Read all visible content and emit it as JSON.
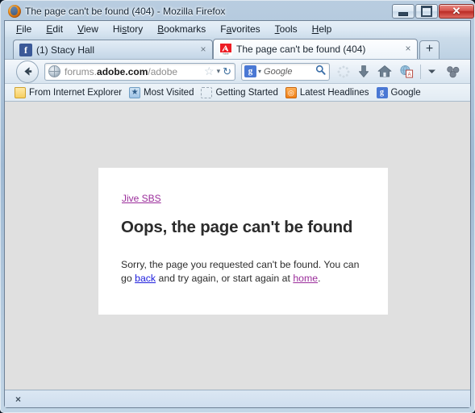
{
  "window": {
    "title": "The page can't be found (404) - Mozilla Firefox",
    "app_icon": "firefox-icon",
    "minimize_label": "",
    "maximize_label": "",
    "close_label": "✕"
  },
  "menubar": {
    "items": [
      {
        "name": "file",
        "pre": "",
        "key": "F",
        "post": "ile"
      },
      {
        "name": "edit",
        "pre": "",
        "key": "E",
        "post": "dit"
      },
      {
        "name": "view",
        "pre": "",
        "key": "V",
        "post": "iew"
      },
      {
        "name": "history",
        "pre": "Hi",
        "key": "s",
        "post": "tory"
      },
      {
        "name": "bookmarks",
        "pre": "",
        "key": "B",
        "post": "ookmarks"
      },
      {
        "name": "favorites",
        "pre": "F",
        "key": "a",
        "post": "vorites"
      },
      {
        "name": "tools",
        "pre": "",
        "key": "T",
        "post": "ools"
      },
      {
        "name": "help",
        "pre": "",
        "key": "H",
        "post": "elp"
      }
    ]
  },
  "tabs": [
    {
      "title": "(1) Stacy Hall",
      "favicon": "facebook-icon",
      "favicon_glyph": "f",
      "close_label": "×",
      "active": false
    },
    {
      "title": "The page can't be found (404)",
      "favicon": "adobe-icon",
      "favicon_glyph": "A",
      "close_label": "×",
      "active": true
    }
  ],
  "newtab": {
    "label": "+"
  },
  "navbar": {
    "back_button": "back-arrow",
    "url_prefix": "forums.",
    "url_domain": "adobe.com",
    "url_suffix": "/adobe",
    "star_label": "☆",
    "dropdown_label": "▾",
    "reload_label": "↻",
    "search": {
      "engine_glyph": "g",
      "engine_caret": "▾",
      "placeholder": "Google",
      "value": "Google",
      "magnifier": "search-icon"
    },
    "icons": [
      {
        "name": "loading-spinner-icon"
      },
      {
        "name": "download-arrow-icon"
      },
      {
        "name": "home-icon"
      },
      {
        "name": "pdf-converter-icon"
      },
      {
        "name": "toolbar-overflow-chevron-icon"
      },
      {
        "name": "extension-cluster-icon"
      }
    ]
  },
  "bookmarks": [
    {
      "label": "From Internet Explorer",
      "icon": "folder-icon"
    },
    {
      "label": "Most Visited",
      "icon": "most-visited-icon"
    },
    {
      "label": "Getting Started",
      "icon": "getting-started-icon"
    },
    {
      "label": "Latest Headlines",
      "icon": "rss-icon"
    },
    {
      "label": "Google",
      "icon": "google-icon",
      "icon_glyph": "g"
    }
  ],
  "page": {
    "brand_link": "Jive SBS",
    "heading": "Oops, the page can't be found",
    "body_part1": "Sorry, the page you requested can't be found. You can go ",
    "body_link_back": "back",
    "body_part2": " and try again, or start again at ",
    "body_link_home": "home",
    "body_part3": ".",
    "background_color": "#e0e0e0",
    "content_color": "#ffffff",
    "visited_link_color": "#9b2d9b",
    "unvisited_link_color": "#2020dd"
  },
  "findbar": {
    "close_label": "×"
  }
}
